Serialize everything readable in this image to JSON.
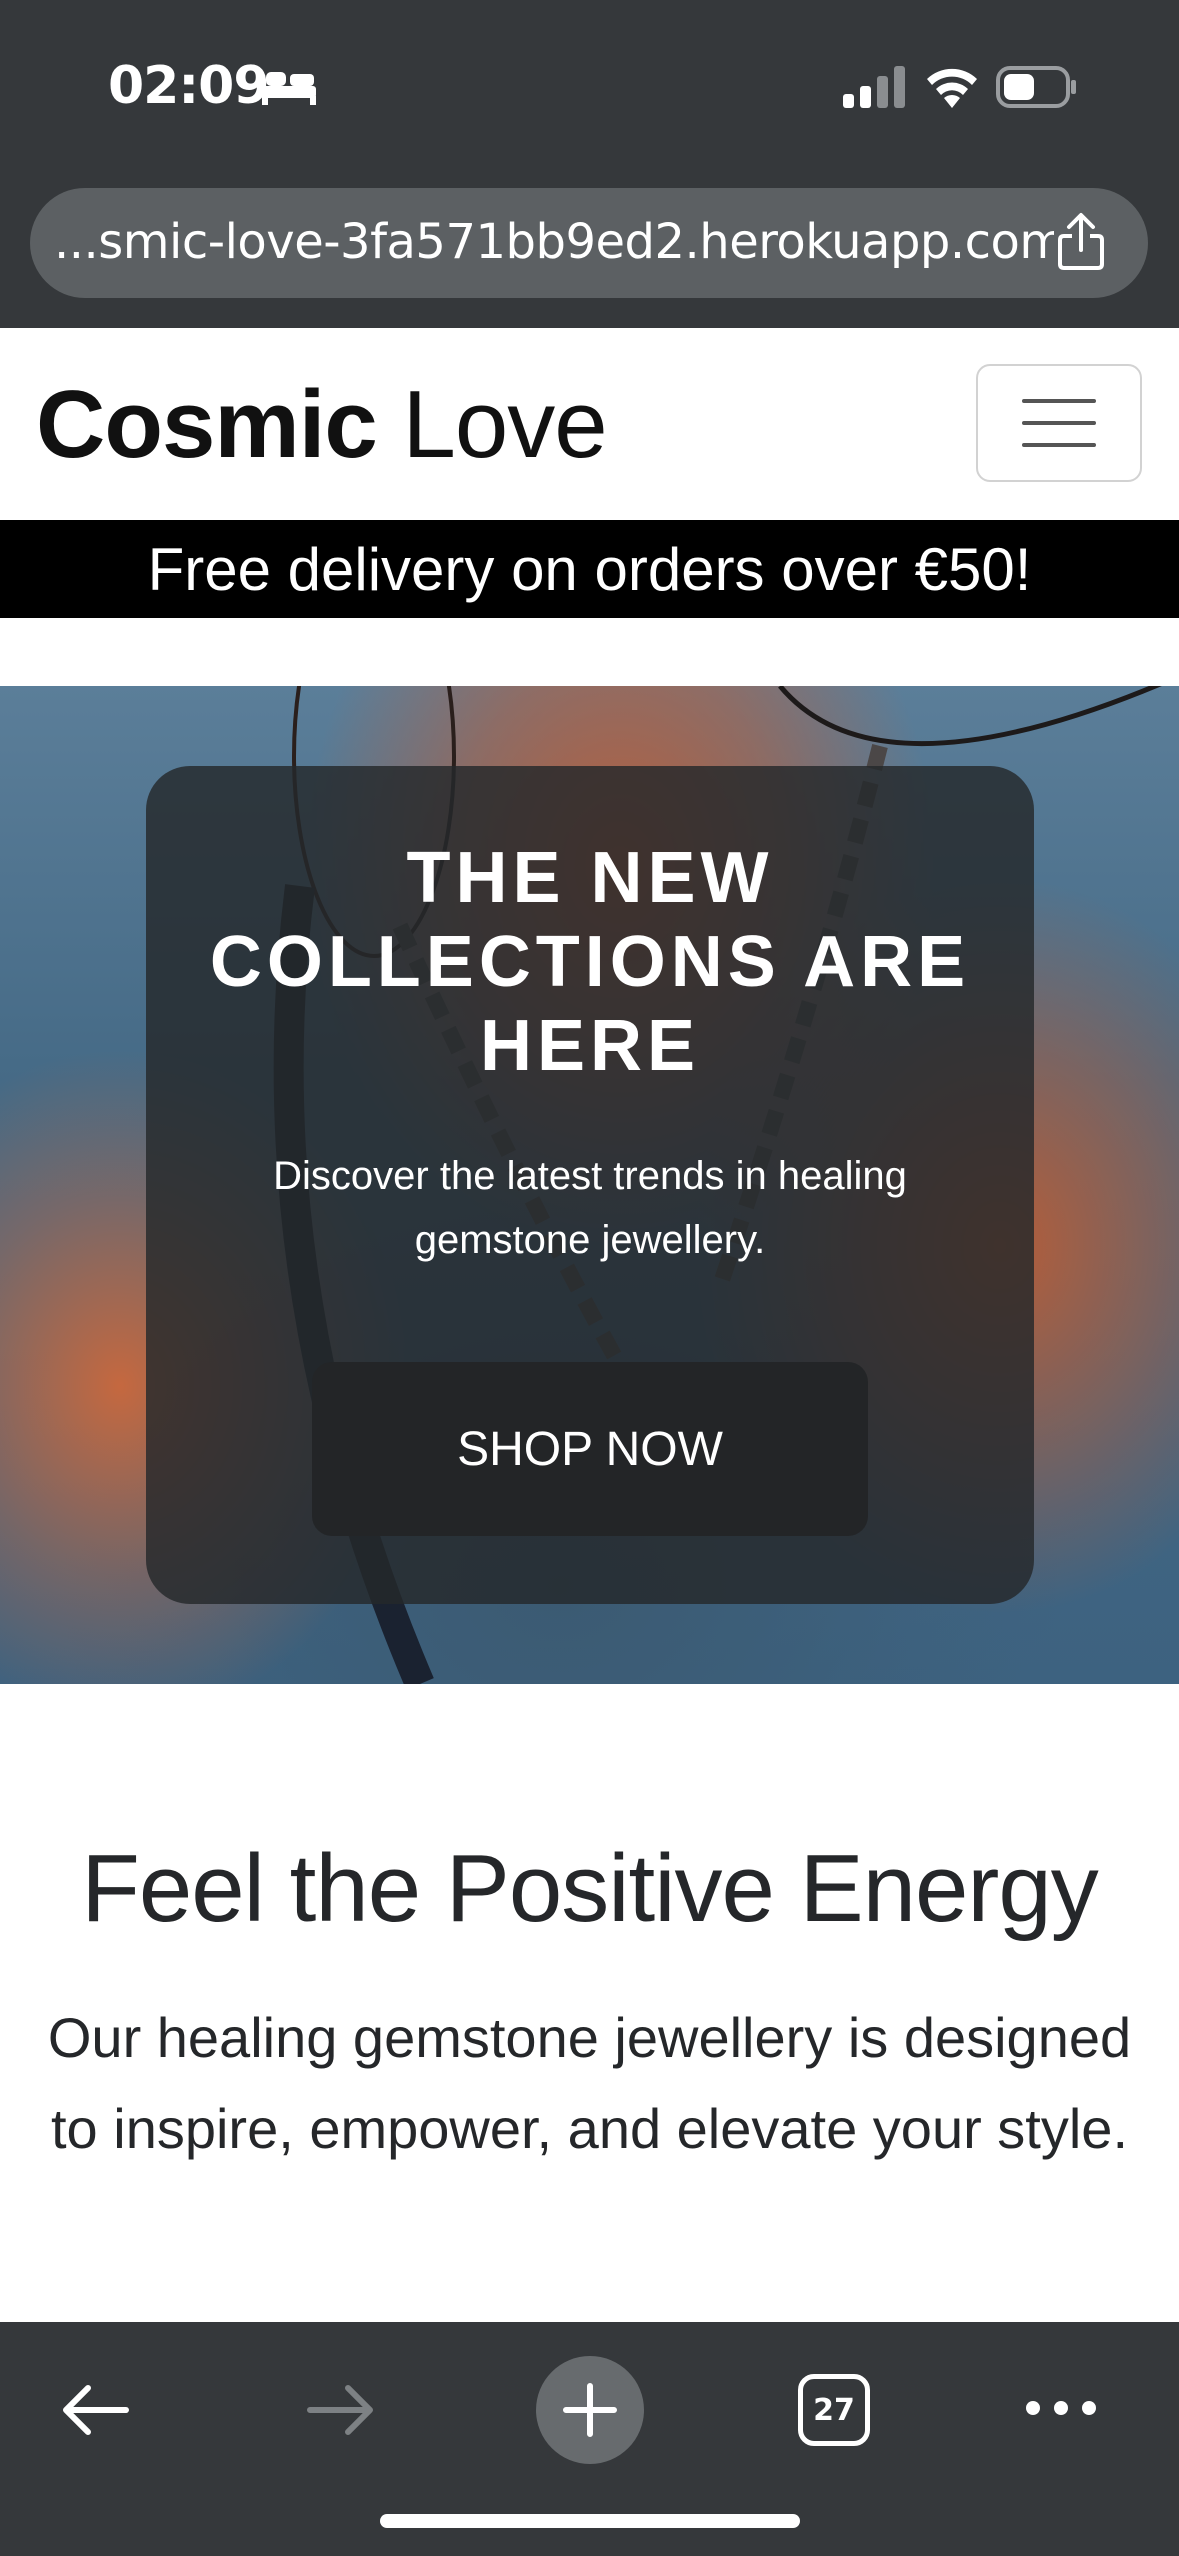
{
  "status_bar": {
    "time": "02:09",
    "icons": [
      "bed-icon",
      "cellular-signal-icon",
      "wifi-icon",
      "battery-icon"
    ]
  },
  "browser": {
    "url": "...smic-love-3fa571bb9ed2.herokuapp.com",
    "tab_count": "27",
    "toolbar_icons": [
      "back-arrow-icon",
      "forward-arrow-icon",
      "plus-icon",
      "tabs-icon",
      "more-icon"
    ]
  },
  "header": {
    "brand_bold": "Cosmic",
    "brand_light": "Love",
    "menu_icon": "hamburger-icon"
  },
  "promo": {
    "text": "Free delivery on orders over €50!"
  },
  "hero": {
    "title": "THE NEW COLLECTIONS ARE HERE",
    "subtitle": "Discover the latest trends in healing gemstone jewellery.",
    "cta_label": "SHOP NOW"
  },
  "intro": {
    "heading": "Feel the Positive Energy",
    "text": "Our healing gemstone jewellery is designed to inspire, empower, and elevate your style."
  },
  "colors": {
    "chrome": "#35383b",
    "banner": "#000000",
    "card": "#25282b",
    "text_dark": "#25272a"
  }
}
